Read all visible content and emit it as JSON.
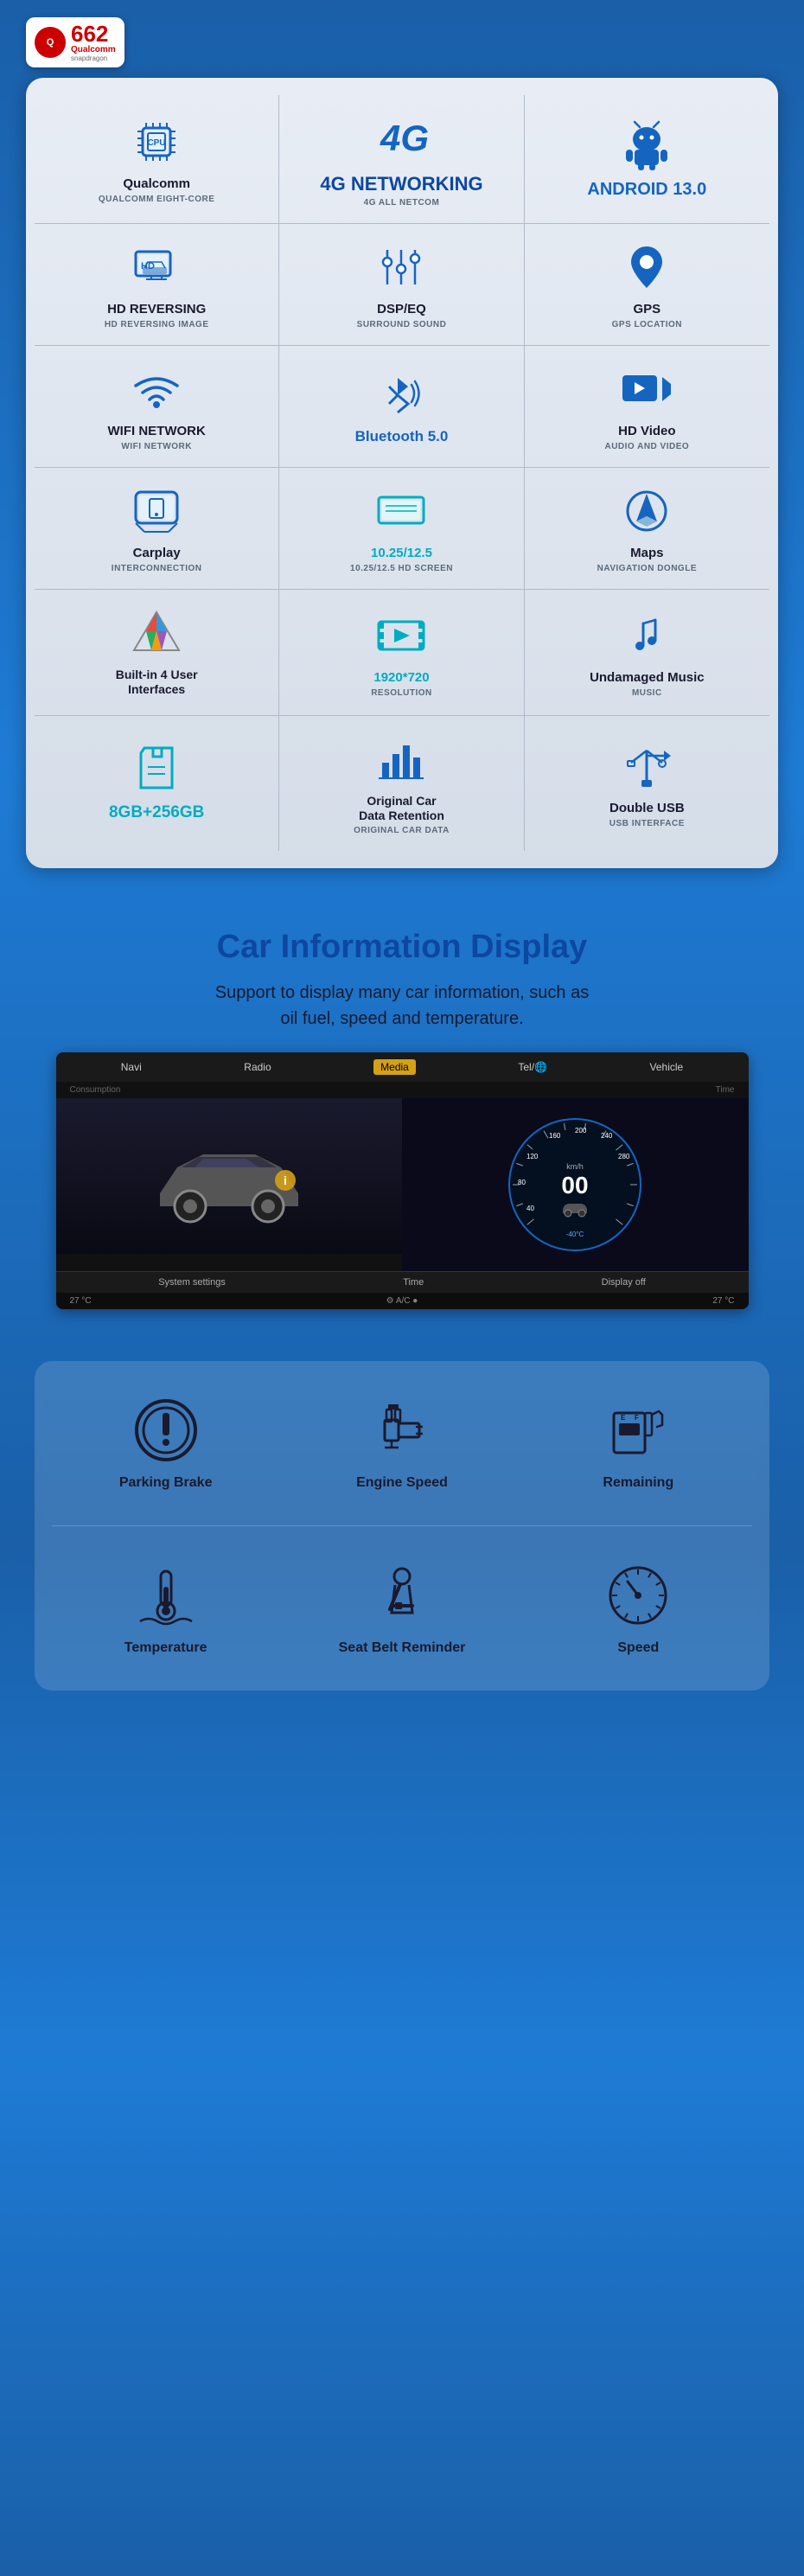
{
  "badge": {
    "number": "662",
    "brand": "Qualcomm",
    "model": "snapdragon"
  },
  "features": [
    {
      "id": "cpu",
      "icon": "cpu",
      "title": "Qualcomm",
      "subtitle": "QUALCOMM EIGHT-CORE",
      "style": "normal"
    },
    {
      "id": "4g",
      "icon": "4g",
      "title": "4G NETWORKING",
      "subtitle": "4G ALL NETCOM",
      "style": "large"
    },
    {
      "id": "android",
      "icon": "android",
      "title": "ANDROID 13.0",
      "subtitle": "",
      "style": "android"
    },
    {
      "id": "hd-reversing",
      "icon": "hd-reversing",
      "title": "HD REVERSING",
      "subtitle": "HD REVERSING IMAGE",
      "style": "normal"
    },
    {
      "id": "dsp",
      "icon": "dsp",
      "title": "DSP/EQ",
      "subtitle": "SURROUND SOUND",
      "style": "normal"
    },
    {
      "id": "gps",
      "icon": "gps",
      "title": "GPS",
      "subtitle": "GPS LOCATION",
      "style": "normal"
    },
    {
      "id": "wifi",
      "icon": "wifi",
      "title": "WIFI NETWORK",
      "subtitle": "WIFI NETWORK",
      "style": "normal"
    },
    {
      "id": "bluetooth",
      "icon": "bluetooth",
      "title": "Bluetooth 5.0",
      "subtitle": "",
      "style": "blue-large"
    },
    {
      "id": "hd-video",
      "icon": "hd-video",
      "title": "HD Video",
      "subtitle": "AUDIO AND VIDEO",
      "style": "normal"
    },
    {
      "id": "carplay",
      "icon": "carplay",
      "title": "Carplay",
      "subtitle": "INTERCONNECTION",
      "style": "normal"
    },
    {
      "id": "screen",
      "icon": "screen",
      "title": "10.25/12.5",
      "subtitle": "10.25/12.5 HD SCREEN",
      "style": "cyan"
    },
    {
      "id": "maps",
      "icon": "maps",
      "title": "Maps",
      "subtitle": "NAVIGATION DONGLE",
      "style": "normal"
    },
    {
      "id": "builtin",
      "icon": "builtin",
      "title": "Built-in 4 User\nInterfaces",
      "subtitle": "",
      "style": "normal"
    },
    {
      "id": "resolution",
      "icon": "resolution",
      "title": "1920*720",
      "subtitle": "Resolution",
      "style": "cyan"
    },
    {
      "id": "music",
      "icon": "music",
      "title": "Undamaged Music",
      "subtitle": "MUSIC",
      "style": "normal"
    },
    {
      "id": "storage",
      "icon": "storage",
      "title": "8GB+256GB",
      "subtitle": "",
      "style": "cyan"
    },
    {
      "id": "car-data",
      "icon": "car-data",
      "title": "Original Car\nData Retention",
      "subtitle": "ORIGINAL CAR DATA",
      "style": "normal"
    },
    {
      "id": "usb",
      "icon": "usb",
      "title": "Double USB",
      "subtitle": "USB INTERFACE",
      "style": "normal"
    }
  ],
  "car_info": {
    "title": "Car Information Display",
    "description": "Support to display many car information, such as\noil fuel, speed and temperature.",
    "screen": {
      "tabs": [
        "Navi",
        "Radio",
        "Media",
        "Tel/🌐",
        "Vehicle"
      ],
      "active_tab": "Media",
      "footer_items": [
        "System settings",
        "Time",
        "Display off"
      ],
      "status": [
        "27 °C",
        "A/C ●",
        "27 °C"
      ]
    },
    "speedometer": {
      "value": "00",
      "unit": "km/h",
      "max": 280
    },
    "icons": [
      {
        "id": "parking-brake",
        "label": "Parking Brake",
        "icon": "parking-brake"
      },
      {
        "id": "engine-speed",
        "label": "Engine Speed",
        "icon": "engine"
      },
      {
        "id": "remaining",
        "label": "Remaining",
        "icon": "fuel"
      },
      {
        "id": "temperature",
        "label": "Temperature",
        "icon": "temperature"
      },
      {
        "id": "seat-belt",
        "label": "Seat Belt Reminder",
        "icon": "seat-belt"
      },
      {
        "id": "speed",
        "label": "Speed",
        "icon": "speedometer"
      }
    ]
  }
}
